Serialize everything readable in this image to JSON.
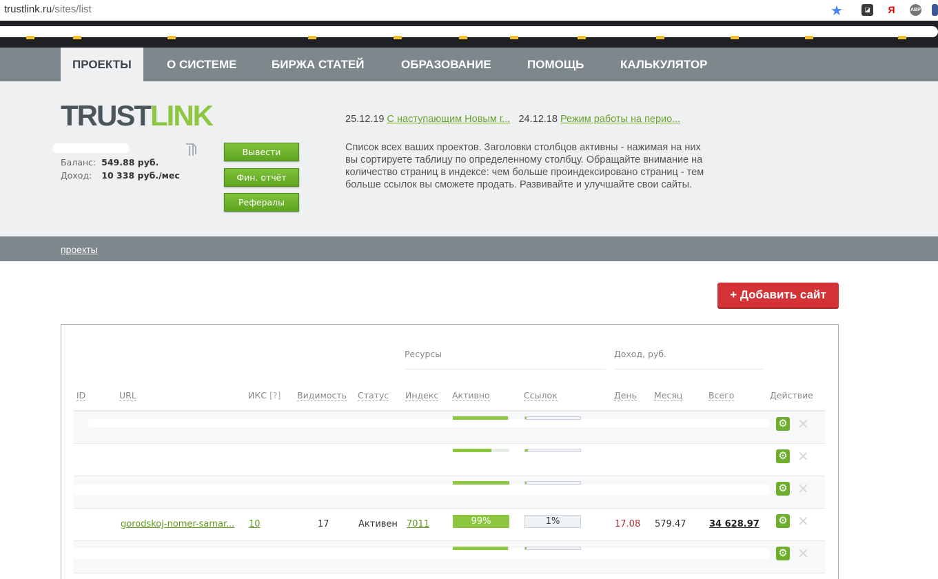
{
  "browser": {
    "url_host": "trustlink.ru",
    "url_path": "/sites/list",
    "extensions": [
      "",
      "Я",
      "ABP",
      ""
    ]
  },
  "nav": {
    "items": [
      "ПРОЕКТЫ",
      "О СИСТЕМЕ",
      "БИРЖА СТАТЕЙ",
      "ОБРАЗОВАНИЕ",
      "ПОМОЩЬ",
      "КАЛЬКУЛЯТОР"
    ]
  },
  "logo": {
    "part1": "TRUST",
    "part2": "LINK"
  },
  "account": {
    "balance_label": "Баланс:",
    "balance_value": "549.88  руб.",
    "income_label": "Доход:",
    "income_value": "10 338 руб./мес"
  },
  "buttons": {
    "withdraw": "Вывести",
    "report": "Фин. отчёт",
    "referrals": "Рефералы",
    "add_site": "+ Добавить сайт"
  },
  "news": {
    "date1": "25.12.19",
    "title1": "С наступающим Новым г...",
    "date2": "24.12.18",
    "title2": "Режим работы на перио..."
  },
  "description": "Список всех ваших проектов. Заголовки столбцов активны - нажимая на них вы сортируете таблицу по определенному столбцу. Обращайте внимание на количество страниц в индексе: чем больше проиндексировано страниц - тем больше ссылок вы сможете продать. Развивайте и улучшайте свои сайты.",
  "breadcrumb": "проекты",
  "table": {
    "groups": {
      "resources": "Ресурсы",
      "income": "Доход,  руб."
    },
    "headers": {
      "id": "ID",
      "url": "URL",
      "iks": "ИКС",
      "iks_help": "[?]",
      "visibility": "Видимость",
      "status": "Статус",
      "index": "Индекс",
      "active": "Активно",
      "links": "Ссылок",
      "day": "День",
      "month": "Месяц",
      "total": "Всего",
      "action": "Действие"
    },
    "row4": {
      "url": "gorodskoj-nomer-samar...",
      "iks": "10",
      "visibility": "17",
      "status": "Активен",
      "index": "7011",
      "active": "99%",
      "links": "1%",
      "day": "17.08",
      "month": "579.47",
      "total": "34 628.97"
    },
    "bars": {
      "row1_active": 0.97,
      "row1_links": 0.02,
      "row2_active": 0.68,
      "row2_links": 0.05,
      "row3_active": 1.0,
      "row3_links": 0.02,
      "row5_active": 0.97,
      "row5_links": 0.02
    },
    "icons": {
      "settings": "gear-icon",
      "delete": "close-icon"
    }
  }
}
